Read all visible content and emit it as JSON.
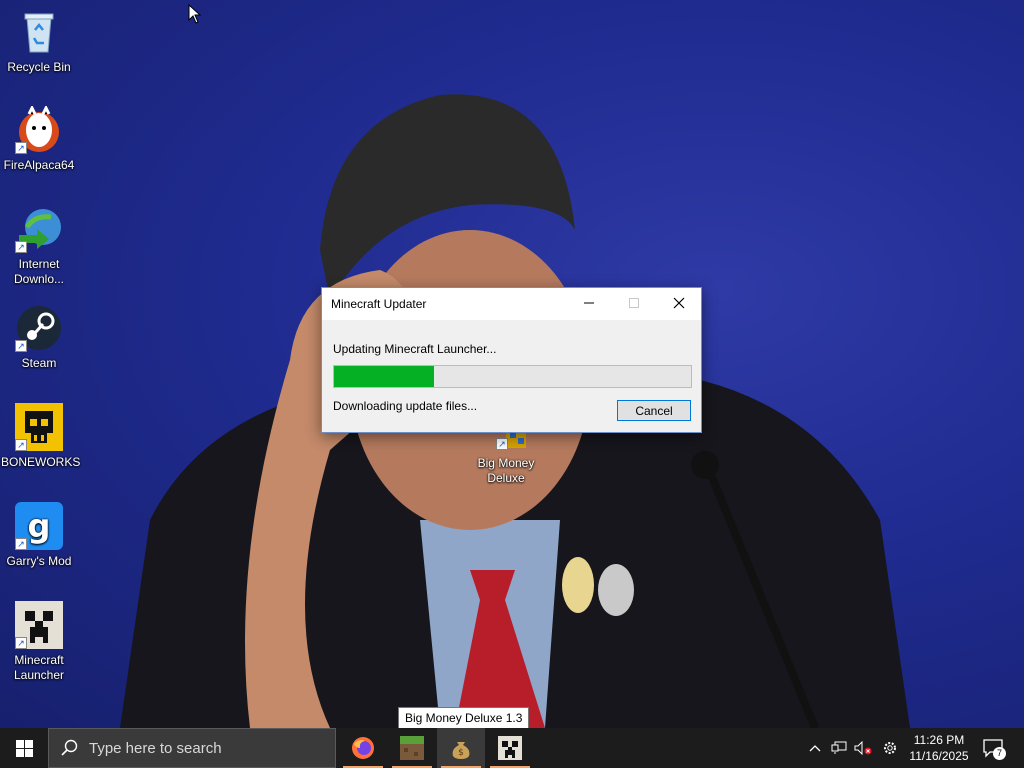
{
  "desktop": {
    "icons": [
      {
        "label": "Recycle Bin"
      },
      {
        "label": "FireAlpaca64"
      },
      {
        "label": "Internet Downlo..."
      },
      {
        "label": "Steam"
      },
      {
        "label": "BONEWORKS"
      },
      {
        "label": "Garry's Mod"
      },
      {
        "label": "Minecraft Launcher"
      },
      {
        "label": "Big Money Deluxe"
      }
    ]
  },
  "dialog": {
    "title": "Minecraft Updater",
    "status": "Updating Minecraft Launcher...",
    "substatus": "Downloading update files...",
    "progress_percent": 28,
    "cancel_label": "Cancel",
    "progress_color": "#06b025"
  },
  "taskbar": {
    "search_placeholder": "Type here to search",
    "apps": [
      {
        "icon": "firefox-icon"
      },
      {
        "icon": "minecraft-grass-icon"
      },
      {
        "icon": "money-bag-icon"
      },
      {
        "icon": "creeper-icon"
      }
    ],
    "tooltip": "Big Money Deluxe 1.3",
    "clock_time": "11:26 PM",
    "clock_date": "11/16/2025",
    "notification_count": "7"
  }
}
